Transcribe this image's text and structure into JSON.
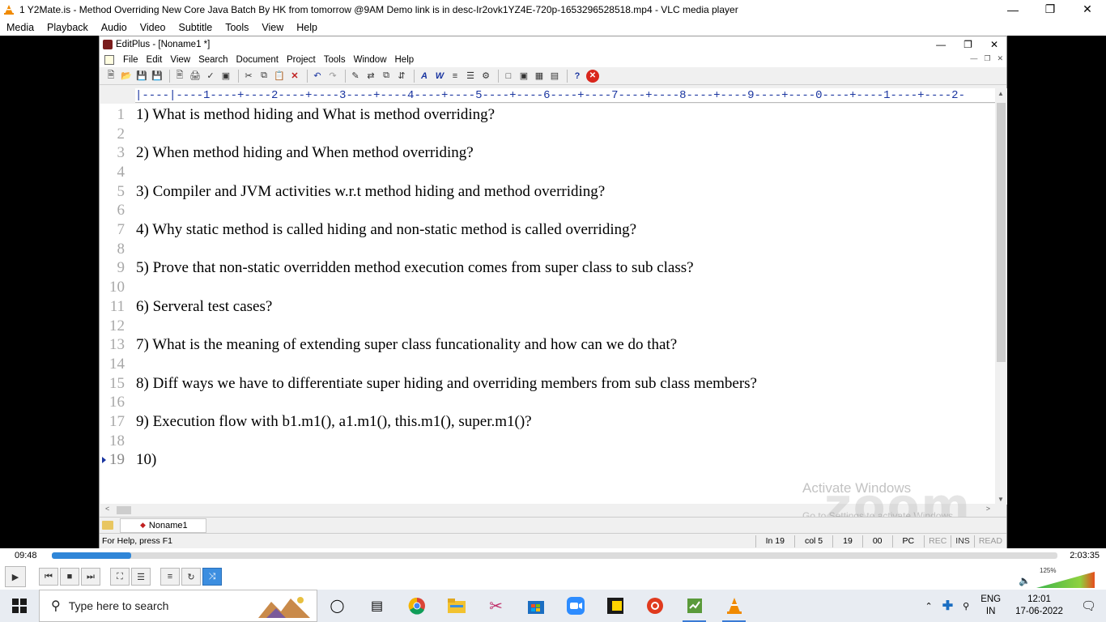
{
  "vlc": {
    "title": "1 Y2Mate.is - Method Overriding  New Core Java Batch By HK from tomorrow @9AM  Demo link is in desc-Ir2ovk1YZ4E-720p-1653296528518.mp4 - VLC media player",
    "menu": [
      "Media",
      "Playback",
      "Audio",
      "Video",
      "Subtitle",
      "Tools",
      "View",
      "Help"
    ],
    "elapsed": "09:48",
    "total": "2:03:35",
    "progress_fraction": 0.079,
    "volume_label": "125%",
    "volume_level": 1.0
  },
  "editplus": {
    "title": "EditPlus - [Noname1 *]",
    "menu": [
      "File",
      "Edit",
      "View",
      "Search",
      "Document",
      "Project",
      "Tools",
      "Window",
      "Help"
    ],
    "ruler": "|----|----1----+----2----+----3----+----4----+----5----+----6----+----7----+----8----+----9----+----0----+----1----+----2-",
    "lines": [
      {
        "n": "1",
        "text": "1) What is method hiding and What is method overriding?"
      },
      {
        "n": "2",
        "text": ""
      },
      {
        "n": "3",
        "text": "2) When method hiding and When method overriding?"
      },
      {
        "n": "4",
        "text": ""
      },
      {
        "n": "5",
        "text": "3) Compiler and JVM activities w.r.t method hiding and method overriding?"
      },
      {
        "n": "6",
        "text": ""
      },
      {
        "n": "7",
        "text": "4) Why static method is called hiding and non-static method is called overriding?"
      },
      {
        "n": "8",
        "text": ""
      },
      {
        "n": "9",
        "text": "5) Prove that non-static overridden method execution comes from super class to sub class?"
      },
      {
        "n": "10",
        "text": ""
      },
      {
        "n": "11",
        "text": "6) Serveral test cases?"
      },
      {
        "n": "12",
        "text": ""
      },
      {
        "n": "13",
        "text": "7) What is the meaning of extending super class funcationality and how can we do that?"
      },
      {
        "n": "14",
        "text": ""
      },
      {
        "n": "15",
        "text": "8) Diff ways we have to differentiate super hiding and overriding members from sub class members?"
      },
      {
        "n": "16",
        "text": ""
      },
      {
        "n": "17",
        "text": "9) Execution flow with b1.m1(), a1.m1(), this.m1(), super.m1()?"
      },
      {
        "n": "18",
        "text": ""
      },
      {
        "n": "19",
        "text": "10)"
      }
    ],
    "tab_label": "Noname1",
    "status": {
      "help": "For Help, press F1",
      "line": "In 19",
      "col": "col 5",
      "total_lines": "19",
      "code": "00",
      "mode": "PC",
      "rec": "REC",
      "ins": "INS",
      "read": "READ"
    },
    "watermark_line1": "Activate Windows",
    "watermark_line2": "Go to Settings to activate Windows.",
    "zoom_logo": "zoom"
  },
  "taskbar": {
    "search_placeholder": "Type here to search",
    "lang_top": "ENG",
    "lang_bottom": "IN",
    "time": "12:01",
    "date": "17-06-2022"
  }
}
